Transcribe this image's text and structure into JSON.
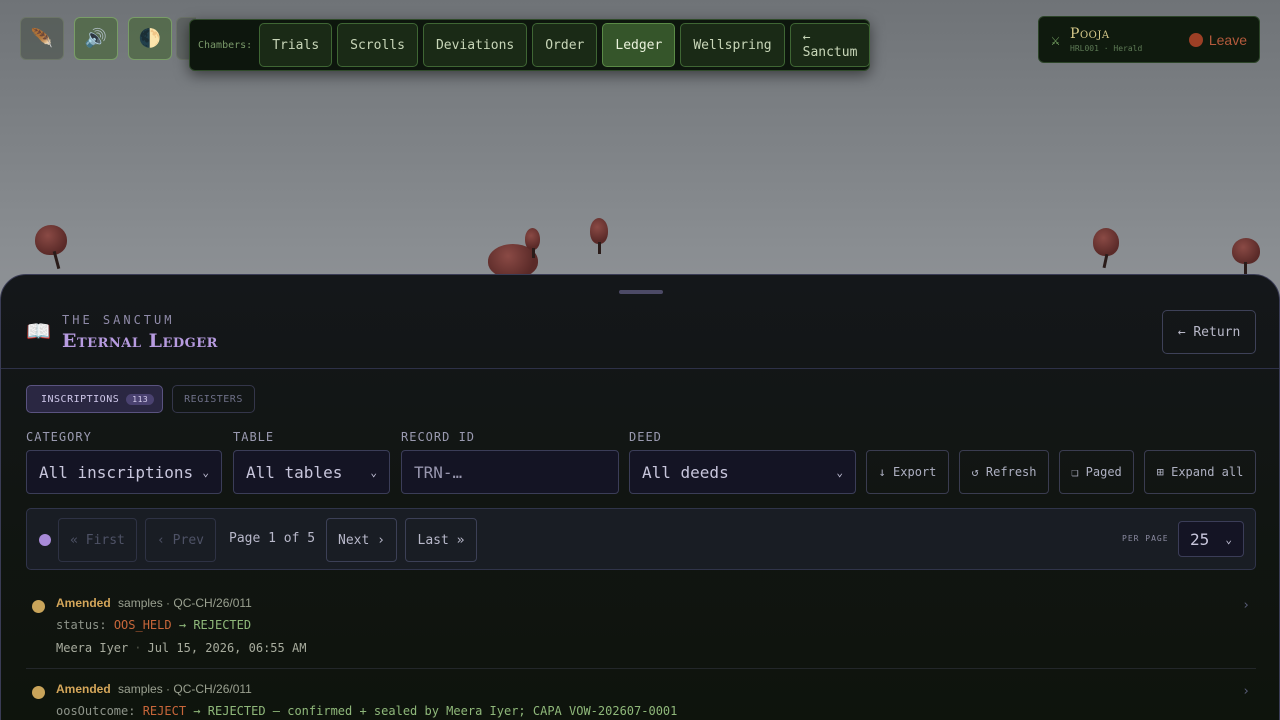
{
  "controls": {
    "icons": [
      "quill-icon",
      "speaker-icon",
      "moon-icon"
    ],
    "glyphs": [
      "🪶",
      "🔊",
      "🌓"
    ]
  },
  "chambers": {
    "label": "Chambers:",
    "items": [
      {
        "label": "Trials"
      },
      {
        "label": "Scrolls"
      },
      {
        "label": "Deviations"
      },
      {
        "label": "Order"
      },
      {
        "label": "Ledger",
        "active": true
      },
      {
        "label": "Wellspring"
      },
      {
        "label": "← Sanctum"
      }
    ]
  },
  "user": {
    "name": "Pooja",
    "role": "HRL001 · Herald",
    "leave_label": "Leave"
  },
  "panel": {
    "eyebrow": "THE SANCTUM",
    "title": "Eternal Ledger",
    "return_label": "← Return",
    "tabs": {
      "inscriptions_label": "INSCRIPTIONS",
      "inscriptions_count": "113",
      "registers_label": "REGISTERS"
    },
    "filters": {
      "category_label": "CATEGORY",
      "category_value": "All inscriptions",
      "table_label": "TABLE",
      "table_value": "All tables",
      "record_label": "RECORD ID",
      "record_placeholder": "TRN-…",
      "deed_label": "DEED",
      "deed_value": "All deeds"
    },
    "actions": {
      "export": "↓ Export",
      "refresh": "↺ Refresh",
      "paged": "❏ Paged",
      "expand": "⊞ Expand all"
    },
    "pager": {
      "first": "« First",
      "prev": "‹ Prev",
      "page_text": "Page 1 of 5",
      "next": "Next ›",
      "last": "Last »",
      "per_page_label": "PER PAGE",
      "per_page_value": "25"
    },
    "entries": [
      {
        "deed": "Amended",
        "context": "samples · QC-CH/26/011",
        "field": "status",
        "from": "OOS_HELD",
        "to": "REJECTED",
        "author": "Meera Iyer",
        "timestamp": "Jul 15, 2026, 06:55 AM"
      },
      {
        "deed": "Amended",
        "context": "samples · QC-CH/26/011",
        "field": "oosOutcome",
        "from": "REJECT",
        "to": "REJECTED — confirmed + sealed by Meera Iyer; CAPA VOW-202607-0001"
      }
    ]
  }
}
